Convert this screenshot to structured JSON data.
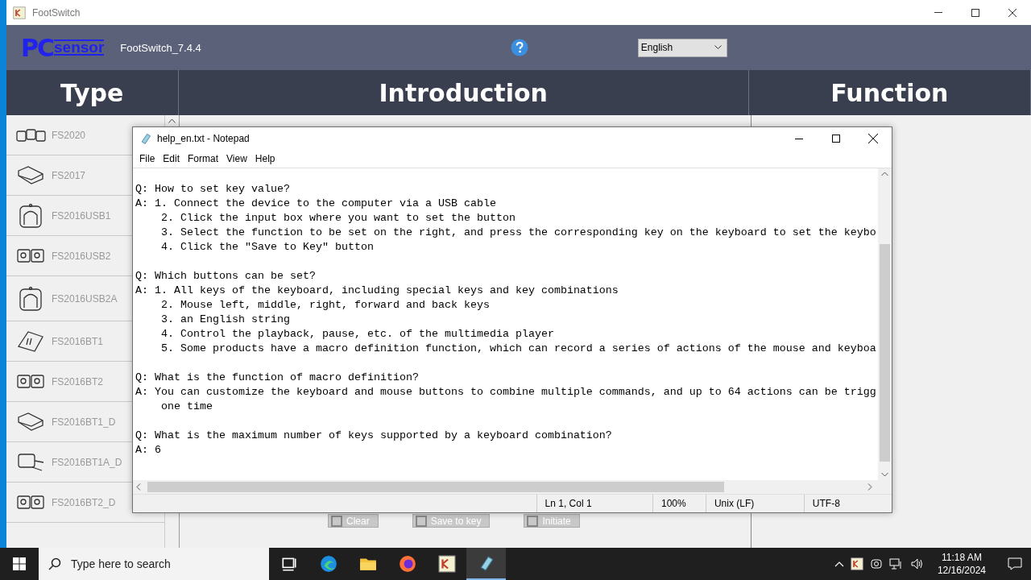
{
  "app_window": {
    "title": "FootSwitch"
  },
  "header": {
    "logo_mark": "PC",
    "logo_text": "sensor",
    "app_name": "FootSwitch_7.4.4",
    "language": {
      "value": "English"
    }
  },
  "columns": [
    "Type",
    "Introduction",
    "Function"
  ],
  "device_list": [
    {
      "name": "FS2020",
      "kind": "triple"
    },
    {
      "name": "FS2017",
      "kind": "flat"
    },
    {
      "name": "FS2016USB1",
      "kind": "dome"
    },
    {
      "name": "FS2016USB2",
      "kind": "double"
    },
    {
      "name": "FS2016USB2A",
      "kind": "dome"
    },
    {
      "name": "FS2016BT1",
      "kind": "tilted"
    },
    {
      "name": "FS2016BT2",
      "kind": "double"
    },
    {
      "name": "FS2016BT1_D",
      "kind": "flat"
    },
    {
      "name": "FS2016BT1A_D",
      "kind": "wired"
    },
    {
      "name": "FS2016BT2_D",
      "kind": "double"
    }
  ],
  "buttons": [
    "Clear",
    "Save to key",
    "Initiate"
  ],
  "notepad": {
    "title": "help_en.txt - Notepad",
    "menu": [
      "File",
      "Edit",
      "Format",
      "View",
      "Help"
    ],
    "paragraphs": [
      [
        "Q: How to set key value?",
        "A: 1. Connect the device to the computer via a USB cable",
        "    2. Click the input box where you want to set the button",
        "    3. Select the function to be set on the right, and press the corresponding key on the keyboard to set the keybo",
        "    4. Click the \"Save to Key\" button"
      ],
      [
        "Q: Which buttons can be set?",
        "A: 1. All keys of the keyboard, including special keys and key combinations",
        "    2. Mouse left, middle, right, forward and back keys",
        "    3. an English string",
        "    4. Control the playback, pause, etc. of the multimedia player",
        "    5. Some products have a macro definition function, which can record a series of actions of the mouse and keyboa"
      ],
      [
        "Q: What is the function of macro definition?",
        "A: You can customize the keyboard and mouse buttons to combine multiple commands, and up to 64 actions can be trigg",
        "    one time"
      ],
      [
        "Q: What is the maximum number of keys supported by a keyboard combination?",
        "A: 6"
      ]
    ],
    "status": [
      "Ln 1, Col 1",
      "100%",
      "Unix (LF)",
      "UTF-8"
    ]
  },
  "taskbar": {
    "search_placeholder": "Type here to search",
    "apps": [
      {
        "kind": "task-view",
        "selected": false
      },
      {
        "kind": "edge",
        "selected": false
      },
      {
        "kind": "folder",
        "selected": false
      },
      {
        "kind": "firefox",
        "selected": false
      },
      {
        "kind": "footswitch",
        "selected": false
      },
      {
        "kind": "notepad",
        "selected": true
      }
    ],
    "time": "11:18 AM",
    "date": "12/16/2024"
  }
}
